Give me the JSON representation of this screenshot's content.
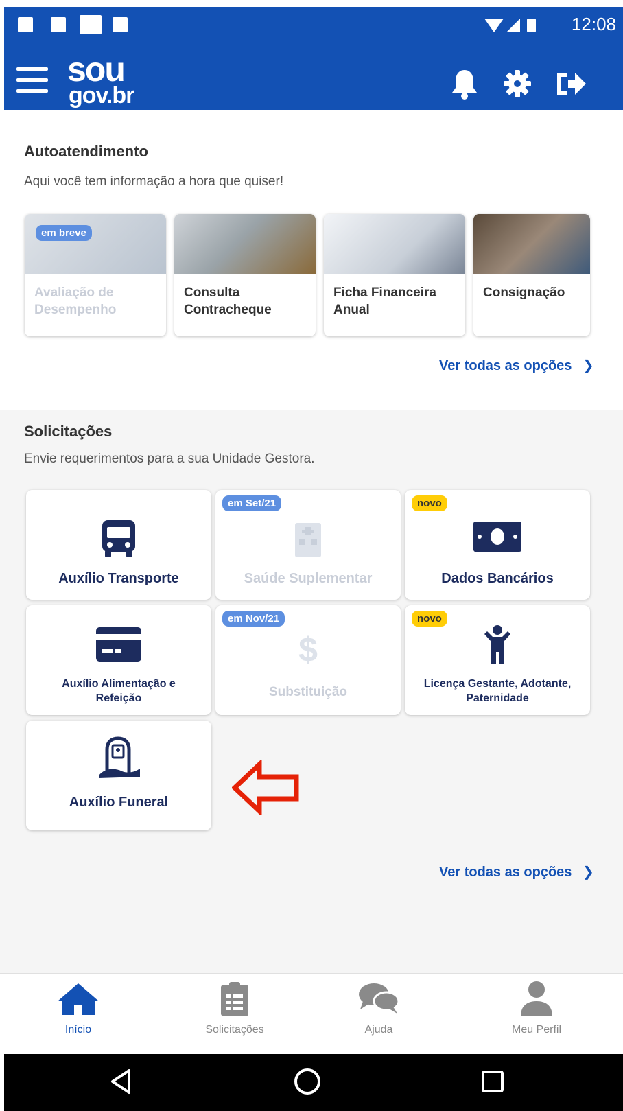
{
  "status_bar": {
    "time": "12:08"
  },
  "header": {
    "logo_top": "sou",
    "logo_bottom": "gov.br"
  },
  "autoatendimento": {
    "title": "Autoatendimento",
    "subtitle": "Aqui você tem informação a hora que quiser!",
    "cards": [
      {
        "label": "Avaliação de Desempenho",
        "badge": "em breve",
        "disabled": true
      },
      {
        "label": "Consulta Contracheque"
      },
      {
        "label": "Ficha Financeira Anual"
      },
      {
        "label": "Consignação"
      }
    ],
    "see_all": "Ver todas as opções"
  },
  "solicitacoes": {
    "title": "Solicitações",
    "subtitle": "Envie requerimentos para a sua Unidade Gestora.",
    "cards": [
      {
        "label": "Auxílio Transporte",
        "icon": "bus-icon"
      },
      {
        "label": "Saúde Suplementar",
        "icon": "hospital-icon",
        "badge": "em Set/21",
        "disabled": true
      },
      {
        "label": "Dados Bancários",
        "icon": "money-icon",
        "badge": "novo"
      },
      {
        "label": "Auxílio Alimentação e Refeição",
        "icon": "credit-card-icon"
      },
      {
        "label": "Substituição",
        "icon": "dollar-icon",
        "badge": "em Nov/21",
        "disabled": true
      },
      {
        "label": "Licença Gestante, Adotante, Paternidade",
        "icon": "child-icon",
        "badge": "novo"
      },
      {
        "label": "Auxílio Funeral",
        "icon": "funeral-icon"
      }
    ],
    "see_all": "Ver todas as opções"
  },
  "bottom_nav": {
    "items": [
      {
        "label": "Início",
        "icon": "home-icon",
        "active": true
      },
      {
        "label": "Solicitações",
        "icon": "clipboard-icon"
      },
      {
        "label": "Ajuda",
        "icon": "chat-icon"
      },
      {
        "label": "Meu Perfil",
        "icon": "user-icon"
      }
    ]
  },
  "colors": {
    "primary": "#1351b4",
    "badge_blue": "#5d8fe0",
    "badge_yellow": "#ffcd07",
    "dark_blue": "#1d2c5e",
    "arrow": "#e52207"
  }
}
